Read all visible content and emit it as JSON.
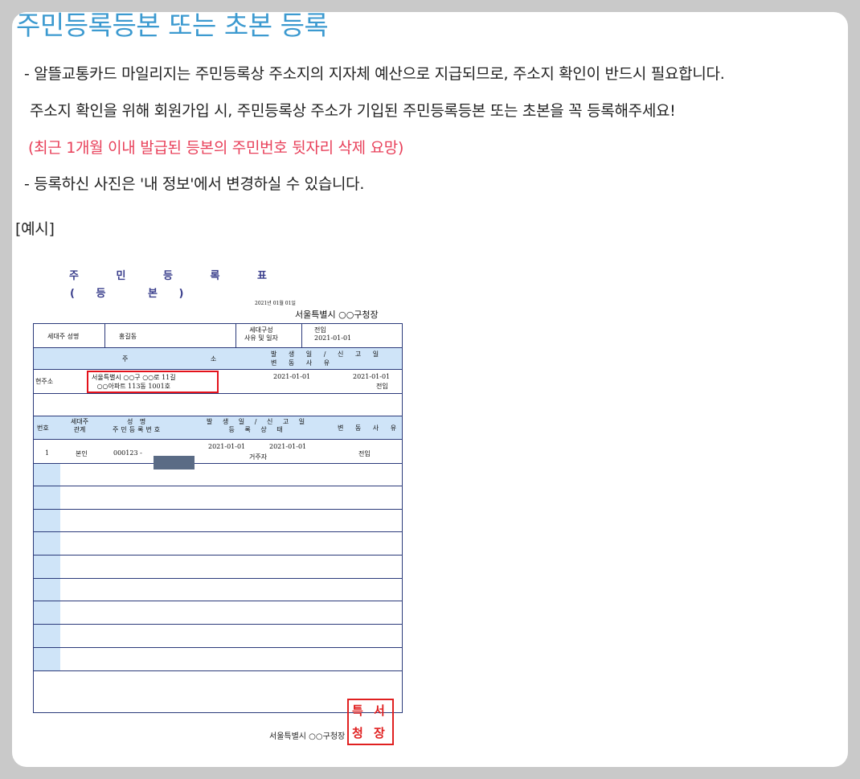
{
  "page": {
    "title": "주민등록등본 또는 초본 등록",
    "lines": [
      "- 알뜰교통카드 마일리지는 주민등록상 주소지의 지자체 예산으로 지급되므로, 주소지 확인이 반드시 필요합니다.",
      "주소지 확인을 위해 회원가입 시, 주민등록상 주소가 기입된 주민등록등본 또는 초본을 꼭 등록해주세요!",
      "(최근 1개월 이내 발급된 등본의 주민번호 뒷자리 삭제 요망)",
      "- 등록하신 사진은 '내 정보'에서 변경하실 수 있습니다."
    ],
    "example_label": "[예시]",
    "accent_color": "#3c9ad0",
    "warning_color": "#e8405a"
  },
  "example_doc": {
    "title_line1": "주 민 등 록 표",
    "title_line2": [
      "(",
      "등",
      "본",
      ")"
    ],
    "issue_date": "2021년 01월 01일",
    "issuer": "서울특별시 ○○구청장",
    "household_head_label": "세대주 성명",
    "household_head": "홍길동",
    "reason_label": "세대구성\n사유 및 일자",
    "reason_value": "전입\n2021-01-01",
    "address_header": "주 소",
    "dates_header": "발 생 일 / 신 고 일\n변 동 사 유",
    "current_address_label": "현주소",
    "current_address": "서울특별시 ○○구 ○○로 11길\n○○아파트 113동 1001호",
    "address_date1": "2021-01-01",
    "address_date2": "2021-01-01",
    "address_reason": "전입",
    "members_headers": {
      "no": "번호",
      "relation": "세대주\n관계",
      "name": "성 명\n주민등록번호",
      "dates": "발 생 일 / 신 고 일\n등 록 상 태",
      "reason": "변 동 사 유"
    },
    "member": {
      "no": "1",
      "relation": "본인",
      "id_prefix": "000123 -",
      "date1": "2021-01-01",
      "date2": "2021-01-01",
      "status": "거주자",
      "reason": "전입"
    },
    "seal_text": [
      "특",
      "서",
      "청",
      "장"
    ],
    "footer_issuer": "서울특별시 ○○구청장",
    "seal_color": "#e02020"
  }
}
